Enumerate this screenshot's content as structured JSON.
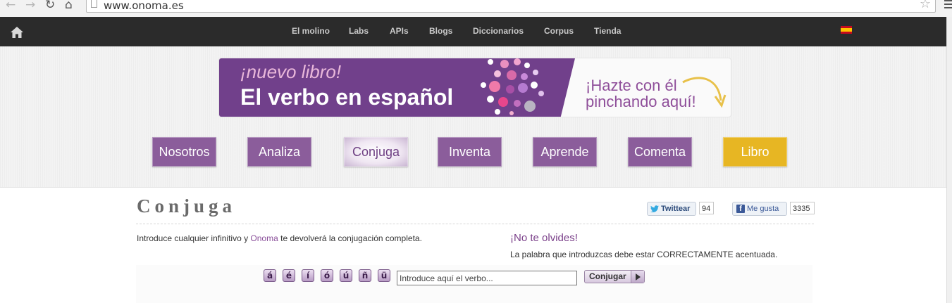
{
  "browser": {
    "url": "www.onoma.es"
  },
  "topnav": {
    "items": [
      "El molino",
      "Labs",
      "APIs",
      "Blogs",
      "Diccionarios",
      "Corpus",
      "Tienda"
    ],
    "language_flag": "spain-flag"
  },
  "banner": {
    "tagline": "¡nuevo libro!",
    "title": "El verbo en español",
    "cta_line1": "¡Hazte con él",
    "cta_line2": "pinchando aquí!"
  },
  "menu": {
    "tabs": [
      {
        "label": "Nosotros",
        "active": false
      },
      {
        "label": "Analiza",
        "active": false
      },
      {
        "label": "Conjuga",
        "active": true
      },
      {
        "label": "Inventa",
        "active": false
      },
      {
        "label": "Aprende",
        "active": false
      },
      {
        "label": "Comenta",
        "active": false
      },
      {
        "label": "Libro",
        "active": false
      }
    ]
  },
  "page": {
    "title": "Conjuga",
    "intro_before": "Introduce cualquier infinitivo y ",
    "intro_brand": "Onoma",
    "intro_after": " te devolverá la conjugación completa.",
    "reminder_title": "¡No te olvides!",
    "reminder_text": "La palabra que introduzcas debe estar CORRECTAMENTE acentuada."
  },
  "social": {
    "twitter_label": "Twittear",
    "twitter_count": "94",
    "facebook_label": "Me gusta",
    "facebook_count": "3335"
  },
  "form": {
    "accent_keys": [
      "á",
      "é",
      "í",
      "ó",
      "ú",
      "ñ",
      "ü"
    ],
    "placeholder": "Introduce aquí el verbo...",
    "submit_label": "Conjugar"
  },
  "colors": {
    "brand_purple": "#71408b",
    "tab_purple": "#8b5d9b",
    "libro_yellow": "#e7b623",
    "topbar": "#2b2b2b"
  }
}
